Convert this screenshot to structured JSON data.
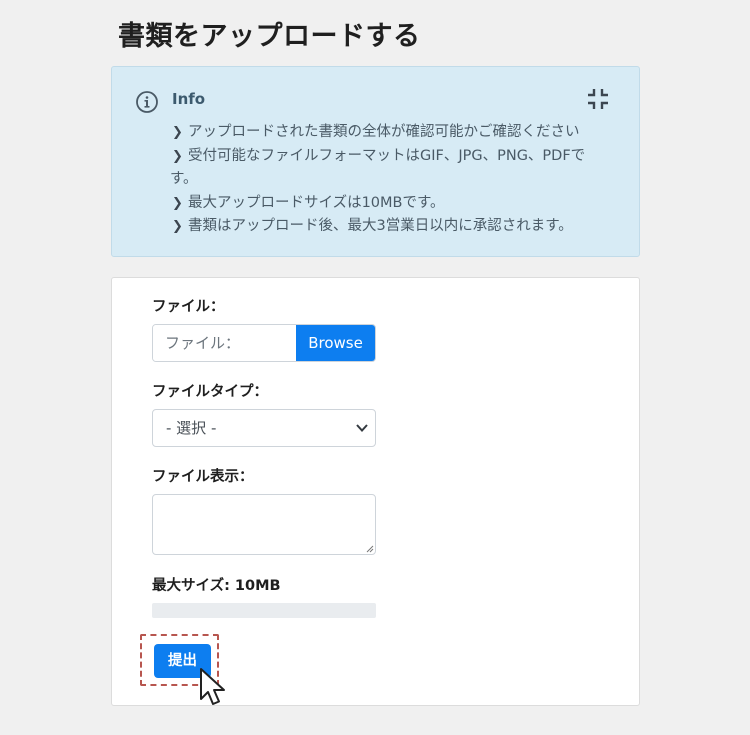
{
  "page": {
    "title": "書類をアップロードする"
  },
  "info": {
    "title": "Info",
    "items": [
      "アップロードされた書類の全体が確認可能かご確認ください",
      "受付可能なファイルフォーマットはGIF、JPG、PNG、PDFで",
      "す。",
      "最大アップロードサイズは10MBです。",
      "書類はアップロード後、最大3営業日以内に承認されます。"
    ],
    "icons": [
      "info-circle-icon",
      "collapse-icon",
      "chevron-right-icon"
    ]
  },
  "form": {
    "file_label": "ファイル：",
    "file_placeholder": "ファイル：",
    "browse_label": "Browse",
    "type_label": "ファイルタイプ：",
    "type_selected": "- 選択 -",
    "display_label": "ファイル表示：",
    "display_value": "",
    "max_size_label": "最大サイズ: 10MB",
    "upload_progress": 0,
    "submit_label": "提出"
  },
  "colors": {
    "accent": "#0d7ef0",
    "info_bg": "#d7ebf5",
    "page_bg": "#f0f0f0",
    "highlight_dashed": "#b7564f"
  }
}
